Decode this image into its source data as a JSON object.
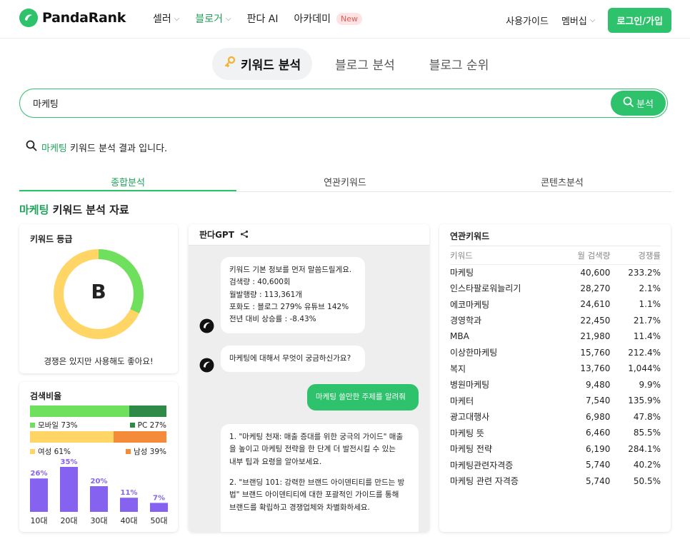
{
  "header": {
    "logo_text": "PandaRank",
    "nav": [
      {
        "label": "셀러",
        "dropdown": true,
        "active": false
      },
      {
        "label": "블로거",
        "dropdown": true,
        "active": true
      },
      {
        "label": "판다 AI",
        "dropdown": false,
        "active": false
      },
      {
        "label": "아카데미",
        "dropdown": false,
        "active": false,
        "badge": "New"
      }
    ],
    "guide_label": "사용가이드",
    "membership_label": "멤버십",
    "login_label": "로그인/가입"
  },
  "top_tabs": [
    {
      "label": "키워드 분석",
      "active": true,
      "icon": "key-icon"
    },
    {
      "label": "블로그 분석",
      "active": false
    },
    {
      "label": "블로그 순위",
      "active": false
    }
  ],
  "search": {
    "value": "마케팅",
    "button_label": "분석"
  },
  "result": {
    "keyword": "마케팅",
    "suffix": "키워드 분석 결과 입니다."
  },
  "sub_tabs": [
    {
      "label": "종합분석",
      "active": true
    },
    {
      "label": "연관키워드",
      "active": false
    },
    {
      "label": "콘텐츠분석",
      "active": false
    }
  ],
  "section": {
    "keyword": "마케팅",
    "suffix": "키워드 분석 자료"
  },
  "grade": {
    "title": "키워드 등급",
    "letter": "B",
    "message": "경쟁은 있지만 사용해도 좋아요!",
    "colors": {
      "green": "#6fe05e",
      "yellow": "#ffd666"
    },
    "green_fraction": 0.32
  },
  "ratio": {
    "title": "검색비율",
    "mobile_label": "모바일 73%",
    "pc_label": "PC 27%",
    "mobile": 73,
    "pc": 27,
    "female_label": "여성 61%",
    "male_label": "남성 39%",
    "female": 61,
    "male": 39,
    "colors": {
      "mobile": "#6fe05e",
      "pc": "#2f8a47",
      "female": "#ffd666",
      "male": "#f58a3a",
      "age": "#8563f0"
    },
    "age": [
      {
        "label": "10대",
        "value": 26,
        "value_label": "26%"
      },
      {
        "label": "20대",
        "value": 35,
        "value_label": "35%"
      },
      {
        "label": "30대",
        "value": 20,
        "value_label": "20%"
      },
      {
        "label": "40대",
        "value": 11,
        "value_label": "11%"
      },
      {
        "label": "50대",
        "value": 7,
        "value_label": "7%"
      }
    ]
  },
  "gpt": {
    "title": "판다GPT",
    "bot1_lines": [
      "키워드 기본 정보를 먼저 말씀드릴게요.",
      "검색량 : 40,600회",
      "월발행량 : 113,361개",
      "포화도 : 블로그 279% 유튜브 142%",
      "전년 대비 상승률 : -8.43%"
    ],
    "bot2": "마케팅에 대해서 무엇이 궁금하신가요?",
    "user": "마케팅 쓸만한 주제를 알려줘",
    "bot3_lines": [
      "1. \"마케팅 천재: 매출 증대를 위한 궁극의 가이드\" 매출",
      "을 높이고 마케팅 전략을 한 단계 더 발전시킬 수 있는",
      "내부 팁과 요령을 알아보세요.",
      "",
      "2. \"브랜딩 101: 강력한 브랜드 아이덴티티를 만드는 방",
      "법\" 브랜드 아이덴티티에 대한 포괄적인 가이드를 통해",
      "브랜드를 확립하고 경쟁업체와 차별화하세요."
    ]
  },
  "related": {
    "title": "연관키워드",
    "headers": [
      "키워드",
      "월 검색량",
      "경쟁률"
    ],
    "rows": [
      [
        "마케팅",
        "40,600",
        "233.2%"
      ],
      [
        "인스타팔로워늘리기",
        "28,270",
        "2.1%"
      ],
      [
        "에코마케팅",
        "24,610",
        "1.1%"
      ],
      [
        "경영학과",
        "22,450",
        "21.7%"
      ],
      [
        "MBA",
        "21,980",
        "11.4%"
      ],
      [
        "이상한마케팅",
        "15,760",
        "212.4%"
      ],
      [
        "복지",
        "13,760",
        "1,044%"
      ],
      [
        "병원마케팅",
        "9,480",
        "9.9%"
      ],
      [
        "마케터",
        "7,540",
        "135.9%"
      ],
      [
        "광고대행사",
        "6,980",
        "47.8%"
      ],
      [
        "마케팅 뜻",
        "6,460",
        "85.5%"
      ],
      [
        "마케팅 전략",
        "6,190",
        "284.1%"
      ],
      [
        "마케팅관련자격증",
        "5,740",
        "40.2%"
      ],
      [
        "마케팅 관련 자격증",
        "5,740",
        "50.5%"
      ]
    ]
  }
}
